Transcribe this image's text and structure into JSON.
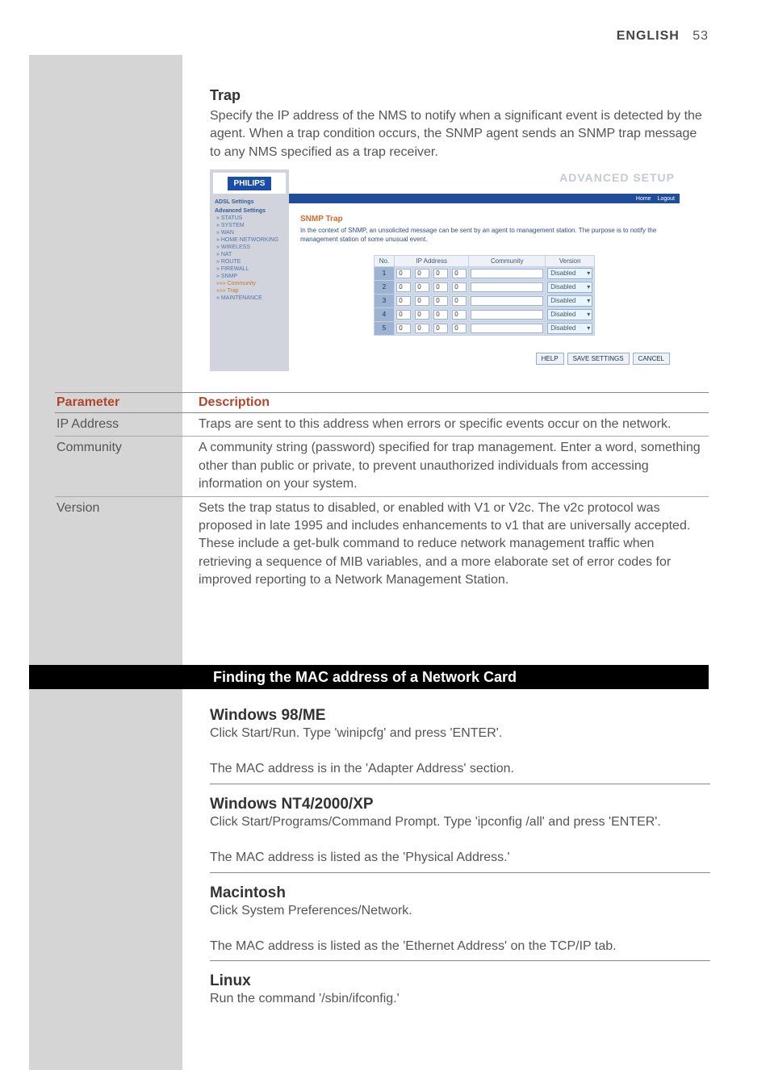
{
  "header": {
    "label": "ENGLISH",
    "page": "53"
  },
  "trap": {
    "heading": "Trap",
    "text": "Specify the IP address of the NMS to notify when a significant event is detected by the agent. When a trap condition occurs, the SNMP agent sends an SNMP trap message to any NMS specified as a trap receiver."
  },
  "screenshot": {
    "logo": "PHILIPS",
    "title": "ADVANCED SETUP",
    "topbar": {
      "home": "Home",
      "logout": "Logout"
    },
    "sidebar": {
      "cat1": "ADSL Settings",
      "cat2": "Advanced Settings",
      "items": [
        "» STATUS",
        "» SYSTEM",
        "» WAN",
        "» HOME NETWORKING",
        "» WIRELESS",
        "» NAT",
        "» ROUTE",
        "» FIREWALL",
        "» SNMP"
      ],
      "sel1": "»»» Community",
      "sel2": "»»» Trap",
      "last": "» MAINTENANCE"
    },
    "body": {
      "heading": "SNMP Trap",
      "desc": "In the context of SNMP, an unsolicited message can be sent by an agent to management station. The purpose is to notify the management station of some unusual event.",
      "th_no": "No.",
      "th_ip": "IP Address",
      "th_comm": "Community",
      "th_ver": "Version",
      "rows": [
        {
          "no": "1",
          "v": "Disabled"
        },
        {
          "no": "2",
          "v": "Disabled"
        },
        {
          "no": "3",
          "v": "Disabled"
        },
        {
          "no": "4",
          "v": "Disabled"
        },
        {
          "no": "5",
          "v": "Disabled"
        }
      ],
      "ipcell": "0",
      "btn_help": "HELP",
      "btn_save": "SAVE SETTINGS",
      "btn_cancel": "CANCEL"
    }
  },
  "paramtable": {
    "h1": "Parameter",
    "h2": "Description",
    "rows": [
      {
        "p": "IP Address",
        "d": "Traps are sent to this address when errors or specific events occur on the network."
      },
      {
        "p": "Community",
        "d": "A community string (password) specified for trap management. Enter a word, something other than public or private, to prevent unauthorized individuals from accessing information on your system."
      },
      {
        "p": "Version",
        "d": "Sets the trap status to disabled, or enabled with V1 or V2c. The v2c protocol was proposed in late 1995 and includes enhancements to v1 that are universally accepted. These include a get-bulk command to reduce network management traffic when retrieving a sequence of MIB variables, and a more elaborate set of error codes for improved reporting to a Network Management Station."
      }
    ]
  },
  "blackbar": "Finding the MAC address of a Network Card",
  "sections": {
    "win98": {
      "h": "Windows 98/ME",
      "l1": "Click Start/Run. Type 'winipcfg' and press 'ENTER'.",
      "l2": "The MAC address is in the 'Adapter Address' section."
    },
    "winnt": {
      "h": "Windows NT4/2000/XP",
      "l1": "Click Start/Programs/Command Prompt. Type 'ipconfig /all' and press 'ENTER'.",
      "l2": "The MAC address is listed as the 'Physical Address.'"
    },
    "mac": {
      "h": "Macintosh",
      "l1": "Click System Preferences/Network.",
      "l2": "The MAC address is listed as the 'Ethernet Address' on the TCP/IP tab."
    },
    "linux": {
      "h": "Linux",
      "l1": "Run the command '/sbin/ifconfig.'"
    }
  }
}
